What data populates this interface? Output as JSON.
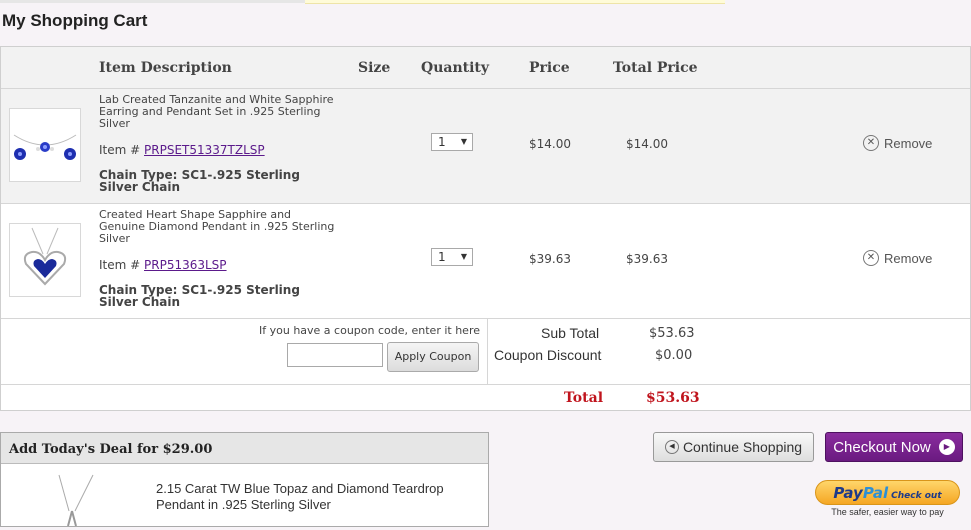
{
  "page_title": "My Shopping Cart",
  "table": {
    "headers": {
      "item_description": "Item Description",
      "size": "Size",
      "quantity": "Quantity",
      "price": "Price",
      "total_price": "Total Price"
    },
    "items": [
      {
        "description": "Lab Created Tanzanite and White Sapphire Earring and Pendant Set in .925 Sterling Silver",
        "item_label": "Item #",
        "item_number": "PRPSET51337TZLSP",
        "chain_type": "Chain Type: SC1-.925 Sterling Silver Chain",
        "quantity": "1",
        "price": "$14.00",
        "total_price": "$14.00",
        "remove_label": "Remove"
      },
      {
        "description": "Created Heart Shape Sapphire and Genuine Diamond Pendant in .925 Sterling Silver",
        "item_label": "Item #",
        "item_number": "PRP51363LSP",
        "chain_type": "Chain Type: SC1-.925 Sterling Silver Chain",
        "quantity": "1",
        "price": "$39.63",
        "total_price": "$39.63",
        "remove_label": "Remove"
      }
    ]
  },
  "coupon": {
    "label": "If you have a coupon code, enter it here",
    "input_value": "",
    "apply_label": "Apply Coupon"
  },
  "summary": {
    "subtotal_label": "Sub Total",
    "subtotal_value": "$53.63",
    "discount_label": "Coupon Discount",
    "discount_value": "$0.00",
    "total_label": "Total",
    "total_value": "$53.63"
  },
  "deal": {
    "title": "Add Today's Deal for $29.00",
    "description": "2.15 Carat TW Blue Topaz and Diamond Teardrop Pendant in .925 Sterling Silver"
  },
  "actions": {
    "continue_label": "Continue Shopping",
    "checkout_label": "Checkout Now",
    "paypal_brand_1": "Pay",
    "paypal_brand_2": "Pal",
    "paypal_button_text": "Check out",
    "paypal_tagline": "The safer, easier way to pay"
  },
  "colors": {
    "accent_purple": "#6a1a80",
    "total_red": "#c0141d",
    "link_purple": "#5b1a8b",
    "paypal_gold": "#f5a623"
  }
}
